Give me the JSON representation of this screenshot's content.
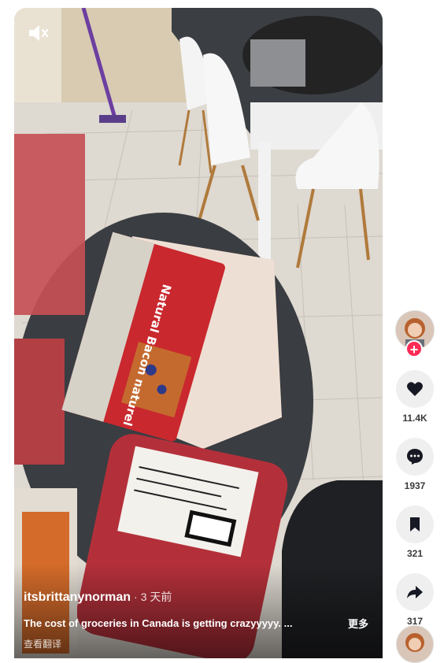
{
  "video": {
    "author": "itsbrittanynorman",
    "separator": "·",
    "posted": "3 天前",
    "description": "The cost of groceries in Canada is getting crazyyyyy. ...",
    "more_label": "更多",
    "translate_label": "查看翻译",
    "package_text": "Natural Bacon naturel",
    "muted": true
  },
  "actions": {
    "likes": "11.4K",
    "comments": "1937",
    "saves": "321",
    "shares": "317"
  },
  "colors": {
    "accent": "#fe2c55",
    "icon": "#161823"
  }
}
